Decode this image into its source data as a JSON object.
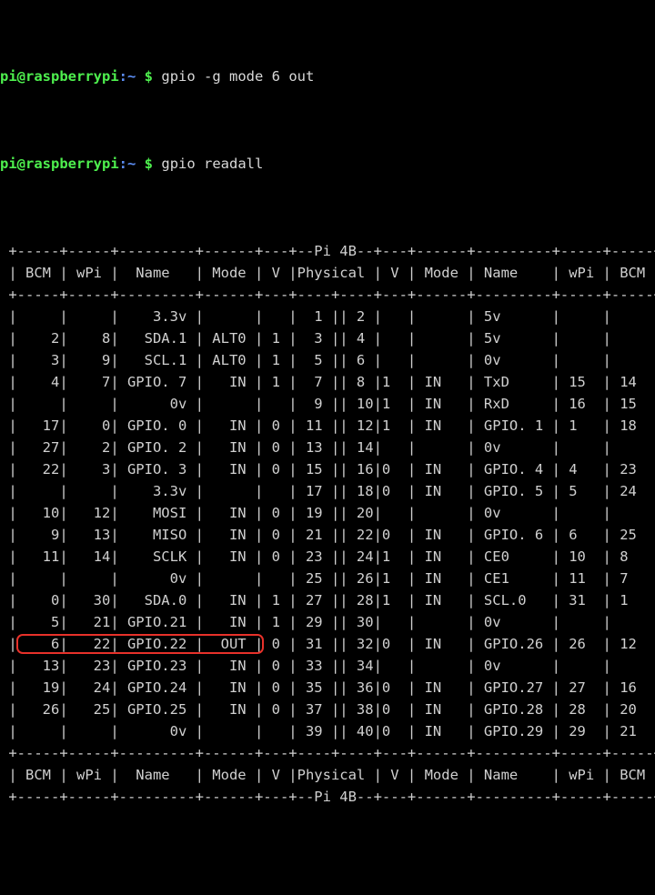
{
  "terminal": {
    "prompt": {
      "user_host": "pi@raspberrypi",
      "path": ":~",
      "symbol": "$"
    },
    "commands": [
      "gpio -g mode 6 out",
      "gpio readall"
    ],
    "board_label": "Pi 4B",
    "columns": [
      "BCM",
      "wPi",
      "Name",
      "Mode",
      "V",
      "Physical",
      "V",
      "Mode",
      "Name",
      "wPi",
      "BCM"
    ],
    "separator_top": " +-----+-----+---------+------+---+---Pi 4B---+---+------+---------+-----+-----+",
    "separator_mid": " +-----+-----+---------+------+---+---++---+---+------+---------+-----+-----+",
    "header_row": " | BCM | wPi |   Name  | Mode | V | Physical | V | Mode | Name    | wPi | BCM |",
    "separator_bottom": " +-----+-----+---------+------+---+---Pi 4B---+---+------+---------+-----+-----+",
    "rows": [
      {
        "bcm_l": "",
        "wpi_l": "",
        "name_l": "3.3v",
        "mode_l": "",
        "v_l": "",
        "phys_l": "1",
        "phys_r": "2",
        "v_r": "",
        "mode_r": "",
        "name_r": "5v",
        "wpi_r": "",
        "bcm_r": ""
      },
      {
        "bcm_l": "2",
        "wpi_l": "8",
        "name_l": "SDA.1",
        "mode_l": "ALT0",
        "v_l": "1",
        "phys_l": "3",
        "phys_r": "4",
        "v_r": "",
        "mode_r": "",
        "name_r": "5v",
        "wpi_r": "",
        "bcm_r": ""
      },
      {
        "bcm_l": "3",
        "wpi_l": "9",
        "name_l": "SCL.1",
        "mode_l": "ALT0",
        "v_l": "1",
        "phys_l": "5",
        "phys_r": "6",
        "v_r": "",
        "mode_r": "",
        "name_r": "0v",
        "wpi_r": "",
        "bcm_r": ""
      },
      {
        "bcm_l": "4",
        "wpi_l": "7",
        "name_l": "GPIO. 7",
        "mode_l": "IN",
        "v_l": "1",
        "phys_l": "7",
        "phys_r": "8",
        "v_r": "1",
        "mode_r": "IN",
        "name_r": "TxD",
        "wpi_r": "15",
        "bcm_r": "14"
      },
      {
        "bcm_l": "",
        "wpi_l": "",
        "name_l": "0v",
        "mode_l": "",
        "v_l": "",
        "phys_l": "9",
        "phys_r": "10",
        "v_r": "1",
        "mode_r": "IN",
        "name_r": "RxD",
        "wpi_r": "16",
        "bcm_r": "15"
      },
      {
        "bcm_l": "17",
        "wpi_l": "0",
        "name_l": "GPIO. 0",
        "mode_l": "IN",
        "v_l": "0",
        "phys_l": "11",
        "phys_r": "12",
        "v_r": "1",
        "mode_r": "IN",
        "name_r": "GPIO. 1",
        "wpi_r": "1",
        "bcm_r": "18"
      },
      {
        "bcm_l": "27",
        "wpi_l": "2",
        "name_l": "GPIO. 2",
        "mode_l": "IN",
        "v_l": "0",
        "phys_l": "13",
        "phys_r": "14",
        "v_r": "",
        "mode_r": "",
        "name_r": "0v",
        "wpi_r": "",
        "bcm_r": ""
      },
      {
        "bcm_l": "22",
        "wpi_l": "3",
        "name_l": "GPIO. 3",
        "mode_l": "IN",
        "v_l": "0",
        "phys_l": "15",
        "phys_r": "16",
        "v_r": "0",
        "mode_r": "IN",
        "name_r": "GPIO. 4",
        "wpi_r": "4",
        "bcm_r": "23"
      },
      {
        "bcm_l": "",
        "wpi_l": "",
        "name_l": "3.3v",
        "mode_l": "",
        "v_l": "",
        "phys_l": "17",
        "phys_r": "18",
        "v_r": "0",
        "mode_r": "IN",
        "name_r": "GPIO. 5",
        "wpi_r": "5",
        "bcm_r": "24"
      },
      {
        "bcm_l": "10",
        "wpi_l": "12",
        "name_l": "MOSI",
        "mode_l": "IN",
        "v_l": "0",
        "phys_l": "19",
        "phys_r": "20",
        "v_r": "",
        "mode_r": "",
        "name_r": "0v",
        "wpi_r": "",
        "bcm_r": ""
      },
      {
        "bcm_l": "9",
        "wpi_l": "13",
        "name_l": "MISO",
        "mode_l": "IN",
        "v_l": "0",
        "phys_l": "21",
        "phys_r": "22",
        "v_r": "0",
        "mode_r": "IN",
        "name_r": "GPIO. 6",
        "wpi_r": "6",
        "bcm_r": "25"
      },
      {
        "bcm_l": "11",
        "wpi_l": "14",
        "name_l": "SCLK",
        "mode_l": "IN",
        "v_l": "0",
        "phys_l": "23",
        "phys_r": "24",
        "v_r": "1",
        "mode_r": "IN",
        "name_r": "CE0",
        "wpi_r": "10",
        "bcm_r": "8"
      },
      {
        "bcm_l": "",
        "wpi_l": "",
        "name_l": "0v",
        "mode_l": "",
        "v_l": "",
        "phys_l": "25",
        "phys_r": "26",
        "v_r": "1",
        "mode_r": "IN",
        "name_r": "CE1",
        "wpi_r": "11",
        "bcm_r": "7"
      },
      {
        "bcm_l": "0",
        "wpi_l": "30",
        "name_l": "SDA.0",
        "mode_l": "IN",
        "v_l": "1",
        "phys_l": "27",
        "phys_r": "28",
        "v_r": "1",
        "mode_r": "IN",
        "name_r": "SCL.0",
        "wpi_r": "31",
        "bcm_r": "1"
      },
      {
        "bcm_l": "5",
        "wpi_l": "21",
        "name_l": "GPIO.21",
        "mode_l": "IN",
        "v_l": "1",
        "phys_l": "29",
        "phys_r": "30",
        "v_r": "",
        "mode_r": "",
        "name_r": "0v",
        "wpi_r": "",
        "bcm_r": ""
      },
      {
        "bcm_l": "6",
        "wpi_l": "22",
        "name_l": "GPIO.22",
        "mode_l": "OUT",
        "v_l": "0",
        "phys_l": "31",
        "phys_r": "32",
        "v_r": "0",
        "mode_r": "IN",
        "name_r": "GPIO.26",
        "wpi_r": "26",
        "bcm_r": "12"
      },
      {
        "bcm_l": "13",
        "wpi_l": "23",
        "name_l": "GPIO.23",
        "mode_l": "IN",
        "v_l": "0",
        "phys_l": "33",
        "phys_r": "34",
        "v_r": "",
        "mode_r": "",
        "name_r": "0v",
        "wpi_r": "",
        "bcm_r": ""
      },
      {
        "bcm_l": "19",
        "wpi_l": "24",
        "name_l": "GPIO.24",
        "mode_l": "IN",
        "v_l": "0",
        "phys_l": "35",
        "phys_r": "36",
        "v_r": "0",
        "mode_r": "IN",
        "name_r": "GPIO.27",
        "wpi_r": "27",
        "bcm_r": "16"
      },
      {
        "bcm_l": "26",
        "wpi_l": "25",
        "name_l": "GPIO.25",
        "mode_l": "IN",
        "v_l": "0",
        "phys_l": "37",
        "phys_r": "38",
        "v_r": "0",
        "mode_r": "IN",
        "name_r": "GPIO.28",
        "wpi_r": "28",
        "bcm_r": "20"
      },
      {
        "bcm_l": "",
        "wpi_l": "",
        "name_l": "0v",
        "mode_l": "",
        "v_l": "",
        "phys_l": "39",
        "phys_r": "40",
        "v_r": "0",
        "mode_r": "IN",
        "name_r": "GPIO.29",
        "wpi_r": "29",
        "bcm_r": "21"
      }
    ],
    "highlight": {
      "row_index": 15,
      "color": "#e8312a",
      "target_pin_name": "GPIO.22",
      "target_mode": "OUT"
    }
  }
}
